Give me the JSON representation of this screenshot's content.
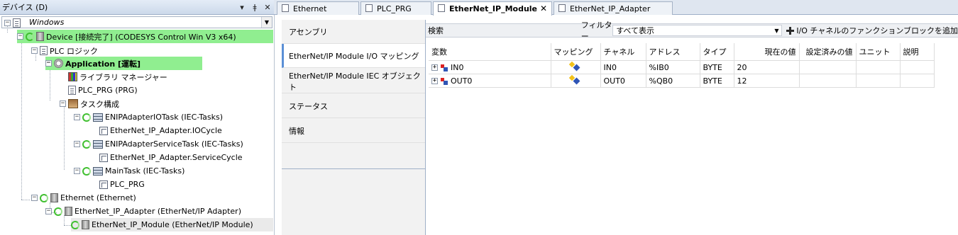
{
  "devices_panel": {
    "title": "デバイス (D)",
    "pin_icon": "pin-icon",
    "close_icon": "close-icon",
    "dropdown_value": "Windows",
    "tree": [
      {
        "label": "Windows",
        "icon": "document-icon"
      },
      {
        "label": "Device [接続完了] (CODESYS Control Win V3 x64)",
        "icon": "device-icon"
      },
      {
        "label": "PLC ロジック",
        "icon": "plc-logic-icon"
      },
      {
        "label": "Application [運転]",
        "icon": "application-gear-icon"
      },
      {
        "label": "ライブラリ マネージャー",
        "icon": "library-icon"
      },
      {
        "label": "PLC_PRG (PRG)",
        "icon": "program-icon"
      },
      {
        "label": "タスク構成",
        "icon": "task-config-icon"
      },
      {
        "label": "ENIPAdapterIOTask (IEC-Tasks)",
        "icon": "task-icon"
      },
      {
        "label": "EtherNet_IP_Adapter.IOCycle",
        "icon": "program-call-icon"
      },
      {
        "label": "ENIPAdapterServiceTask (IEC-Tasks)",
        "icon": "task-icon"
      },
      {
        "label": "EtherNet_IP_Adapter.ServiceCycle",
        "icon": "program-call-icon"
      },
      {
        "label": "MainTask (IEC-Tasks)",
        "icon": "task-icon"
      },
      {
        "label": "PLC_PRG",
        "icon": "program-call-icon"
      },
      {
        "label": "Ethernet (Ethernet)",
        "icon": "device-icon"
      },
      {
        "label": "EtherNet_IP_Adapter (EtherNet/IP Adapter)",
        "icon": "device-icon"
      },
      {
        "label": "EtherNet_IP_Module (EtherNet/IP Module)",
        "icon": "device-icon"
      }
    ]
  },
  "editor_tabs": [
    {
      "label": "Ethernet"
    },
    {
      "label": "PLC_PRG"
    },
    {
      "label": "EtherNet_IP_Module"
    },
    {
      "label": "EtherNet_IP_Adapter"
    }
  ],
  "side_tabs": [
    {
      "label": "アセンブリ"
    },
    {
      "label": "EtherNet/IP Module I/O マッピング"
    },
    {
      "label": "EtherNet/IP Module IEC オブジェクト"
    },
    {
      "label": "ステータス"
    },
    {
      "label": "情報"
    }
  ],
  "toolbar": {
    "search_label": "検索",
    "filter_label": "フィルター",
    "filter_value": "すべて表示",
    "add_fb_label": "I/O チャネルのファンクションブロックを追加"
  },
  "mapping_table": {
    "columns": [
      "変数",
      "マッピング",
      "チャネル",
      "アドレス",
      "タイプ",
      "現在の値",
      "設定済みの値",
      "ユニット",
      "説明"
    ],
    "rows": [
      {
        "variable": "IN0",
        "channel": "IN0",
        "address": "%IB0",
        "type": "BYTE",
        "current_value": "20",
        "direction": "input"
      },
      {
        "variable": "OUT0",
        "channel": "OUT0",
        "address": "%QB0",
        "type": "BYTE",
        "current_value": "12",
        "direction": "output"
      }
    ]
  }
}
